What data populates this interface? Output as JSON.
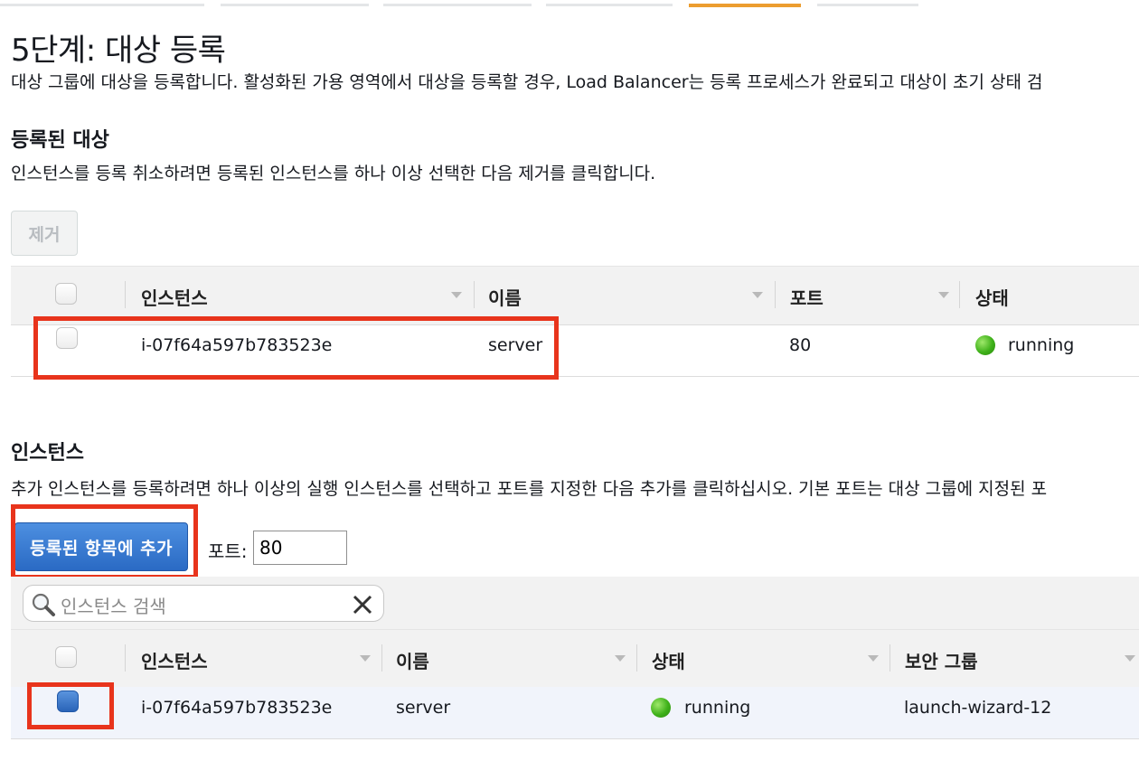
{
  "header": {
    "title": "5단계: 대상 등록",
    "description": "대상 그룹에 대상을 등록합니다. 활성화된 가용 영역에서 대상을 등록할 경우, Load Balancer는 등록 프로세스가 완료되고 대상이 초기 상태 검"
  },
  "registered": {
    "title": "등록된 대상",
    "description": "인스턴스를 등록 취소하려면 등록된 인스턴스를 하나 이상 선택한 다음 제거를 클릭합니다.",
    "remove_label": "제거",
    "columns": [
      "인스턴스",
      "이름",
      "포트",
      "상태"
    ],
    "rows": [
      {
        "instance": "i-07f64a597b783523e",
        "name": "server",
        "port": "80",
        "status": "running"
      }
    ]
  },
  "instances": {
    "title": "인스턴스",
    "description": "추가 인스턴스를 등록하려면 하나 이상의 실행 인스턴스를 선택하고 포트를 지정한 다음 추가를 클릭하십시오. 기본 포트는 대상 그룹에 지정된 포",
    "add_label": "등록된 항목에 추가",
    "port_label": "포트:",
    "port_value": "80",
    "search_placeholder": "인스턴스 검색",
    "columns": [
      "인스턴스",
      "이름",
      "상태",
      "보안 그룹"
    ],
    "rows": [
      {
        "instance": "i-07f64a597b783523e",
        "name": "server",
        "status": "running",
        "security_group": "launch-wizard-12"
      }
    ]
  },
  "colors": {
    "accent_tab": "#ec9d2f",
    "primary_button": "#2a6ac4",
    "highlight_box": "#e8341c",
    "running": "#3fb11a"
  }
}
